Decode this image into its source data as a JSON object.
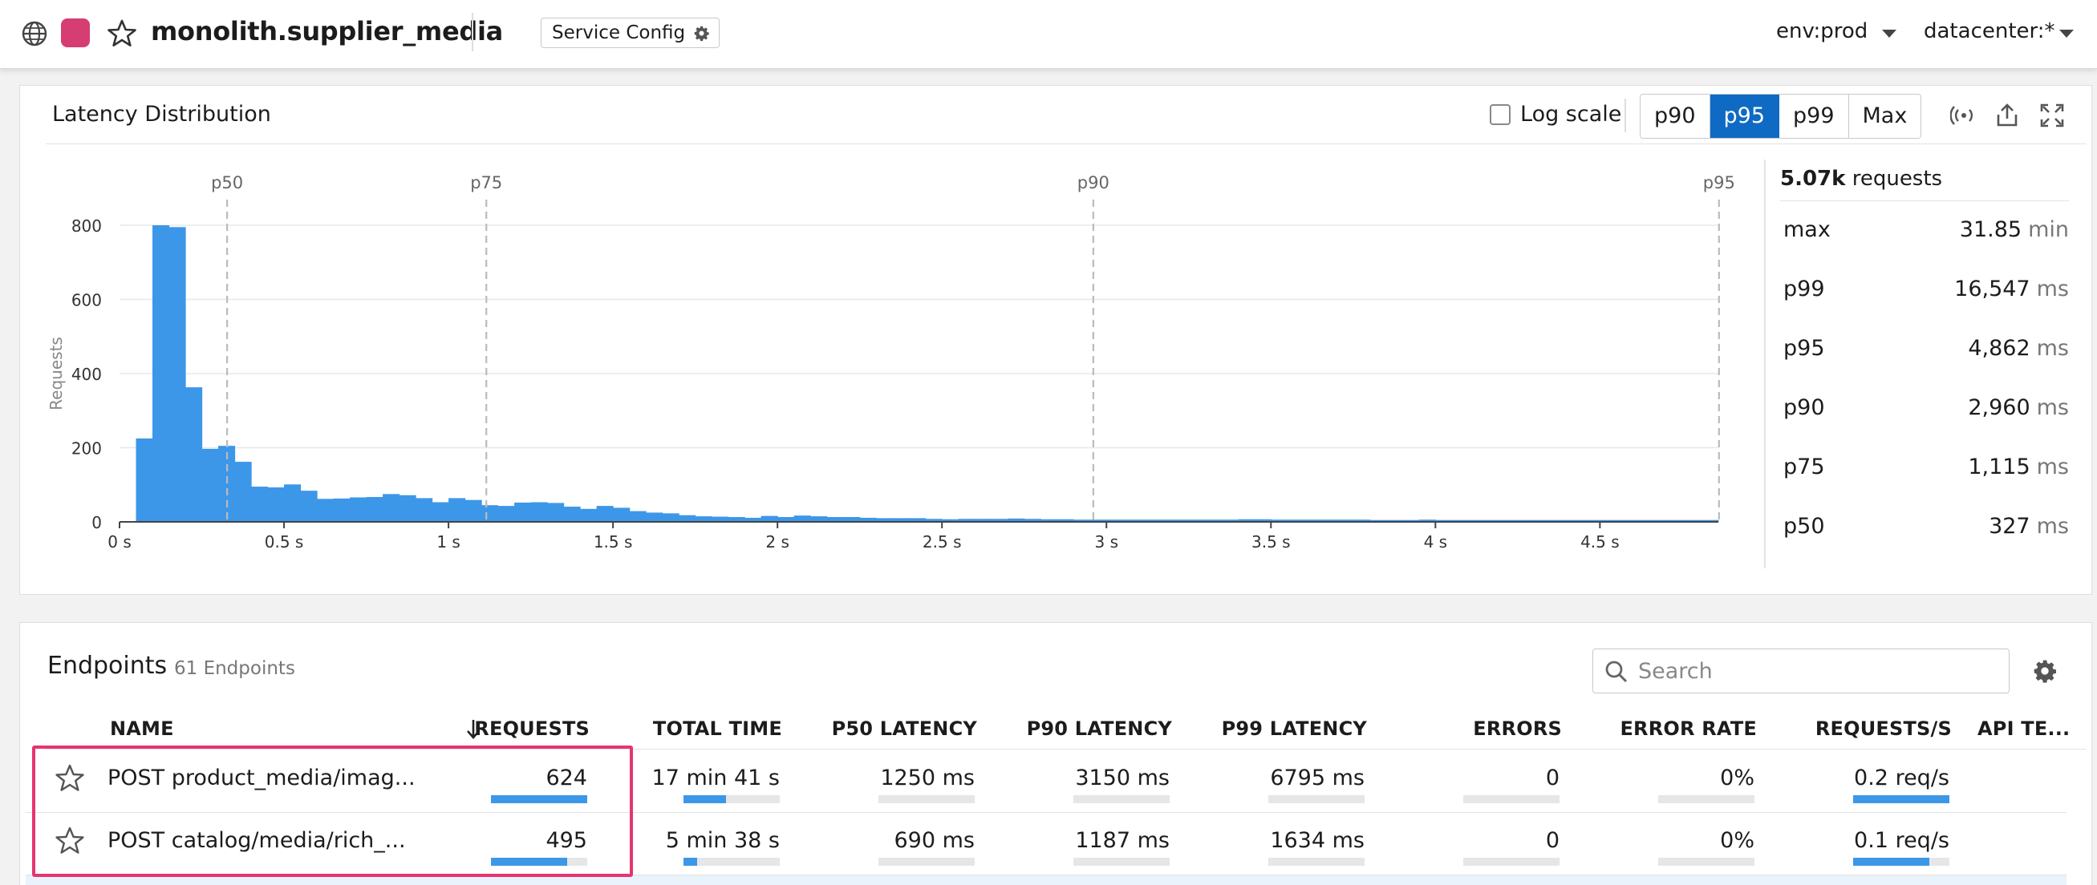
{
  "header": {
    "service_name": "monolith.supplier_media",
    "service_color": "#d63d73",
    "service_config_label": "Service Config",
    "env_filter": "env:prod",
    "datacenter_filter": "datacenter:*",
    "icons": [
      "globe-icon",
      "star-icon",
      "gear-icon",
      "chevron-down-icon"
    ]
  },
  "latency": {
    "title": "Latency Distribution",
    "log_scale_label": "Log scale",
    "log_scale_checked": false,
    "percentile_buttons": [
      "p90",
      "p95",
      "p99",
      "Max"
    ],
    "active_percentile": "p95",
    "toolbar_icons": [
      "live-signal-icon",
      "export-icon",
      "fullscreen-icon"
    ],
    "summary": {
      "count": "5.07k",
      "count_label": "requests"
    },
    "stats": [
      {
        "label": "max",
        "value": "31.85",
        "unit": "min"
      },
      {
        "label": "p99",
        "value": "16,547",
        "unit": "ms"
      },
      {
        "label": "p95",
        "value": "4,862",
        "unit": "ms"
      },
      {
        "label": "p90",
        "value": "2,960",
        "unit": "ms"
      },
      {
        "label": "p75",
        "value": "1,115",
        "unit": "ms"
      },
      {
        "label": "p50",
        "value": "327",
        "unit": "ms"
      }
    ]
  },
  "chart_data": {
    "type": "bar",
    "title": "",
    "xlabel": "",
    "ylabel": "Requests",
    "xlim": [
      0,
      4.86
    ],
    "ylim": [
      0,
      800
    ],
    "x_ticks": [
      "0 s",
      "0.5 s",
      "1 s",
      "1.5 s",
      "2 s",
      "2.5 s",
      "3 s",
      "3.5 s",
      "4 s",
      "4.5 s"
    ],
    "x_tick_values": [
      0,
      0.5,
      1,
      1.5,
      2,
      2.5,
      3,
      3.5,
      4,
      4.5
    ],
    "y_ticks": [
      0,
      200,
      400,
      600,
      800
    ],
    "grid": true,
    "bin_width_s": 0.05,
    "bin_start_s": 0.05,
    "values": [
      225,
      800,
      795,
      363,
      197,
      205,
      162,
      95,
      93,
      101,
      84,
      62,
      63,
      66,
      67,
      75,
      72,
      64,
      53,
      64,
      59,
      45,
      43,
      52,
      53,
      51,
      41,
      35,
      43,
      38,
      29,
      25,
      23,
      18,
      15,
      14,
      13,
      11,
      16,
      13,
      17,
      15,
      13,
      13,
      11,
      10,
      10,
      10,
      8,
      7,
      8,
      8,
      8,
      9,
      8,
      7,
      7,
      6,
      6,
      6,
      6,
      6,
      6,
      6,
      6,
      6,
      6,
      7,
      7,
      6,
      6,
      6,
      6,
      6,
      6,
      5,
      5,
      5,
      6,
      5,
      5,
      5,
      5,
      5,
      5,
      5,
      5,
      5,
      5,
      5,
      5,
      5,
      5,
      5,
      5,
      5,
      5
    ],
    "percentile_markers": [
      {
        "label": "p50",
        "x": 0.327
      },
      {
        "label": "p75",
        "x": 1.115
      },
      {
        "label": "p90",
        "x": 2.96
      },
      {
        "label": "p95",
        "x": 4.862
      }
    ],
    "bar_color": "#3d97e8"
  },
  "endpoints": {
    "title": "Endpoints",
    "count_label": "61 Endpoints",
    "search_placeholder": "Search",
    "columns": [
      "NAME",
      "REQUESTS",
      "TOTAL TIME",
      "P50 LATENCY",
      "P90 LATENCY",
      "P99 LATENCY",
      "ERRORS",
      "ERROR RATE",
      "REQUESTS/S",
      "API TE..."
    ],
    "sorted_column": "REQUESTS",
    "rows": [
      {
        "name": "POST product_media/imag...",
        "requests": "624",
        "requests_fill": 1.0,
        "total_time": "17 min 41 s",
        "total_time_fill": 0.44,
        "p50": "1250 ms",
        "p90": "3150 ms",
        "p99": "6795 ms",
        "errors": "0",
        "error_rate": "0%",
        "req_s": "0.2 req/s",
        "req_s_fill": 1.0
      },
      {
        "name": "POST catalog/media/rich_...",
        "requests": "495",
        "requests_fill": 0.79,
        "total_time": "5 min 38 s",
        "total_time_fill": 0.14,
        "p50": "690 ms",
        "p90": "1187 ms",
        "p99": "1634 ms",
        "errors": "0",
        "error_rate": "0%",
        "req_s": "0.1 req/s",
        "req_s_fill": 0.79
      }
    ],
    "highlight_color": "#e8346e"
  }
}
